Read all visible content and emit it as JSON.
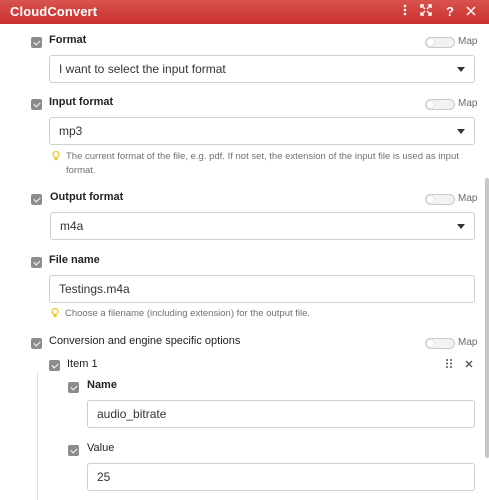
{
  "window": {
    "title": "CloudConvert",
    "icons": [
      "more-vertical-icon",
      "expand-icon",
      "help-icon",
      "close-icon"
    ]
  },
  "map_label": "Map",
  "fields": {
    "format": {
      "label": "Format",
      "value": "I want to select the input format"
    },
    "input_format": {
      "label": "Input format",
      "value": "mp3",
      "hint": "The current format of the file, e.g. pdf. If not set, the extension of the input file is used as input format."
    },
    "output_format": {
      "label": "Output format",
      "value": "m4a"
    },
    "file_name": {
      "label": "File name",
      "value": "Testings.m4a",
      "hint": "Choose a filename (including extension) for the output file."
    },
    "options": {
      "label": "Conversion and engine specific options",
      "item": {
        "label": "Item 1",
        "name": {
          "label": "Name",
          "value": "audio_bitrate"
        },
        "value": {
          "label": "Value",
          "value": "25"
        }
      }
    }
  },
  "colors": {
    "titlebar": "#c9302c",
    "checkbox": "#8c8c8c",
    "hint_icon": "#f0c419"
  }
}
